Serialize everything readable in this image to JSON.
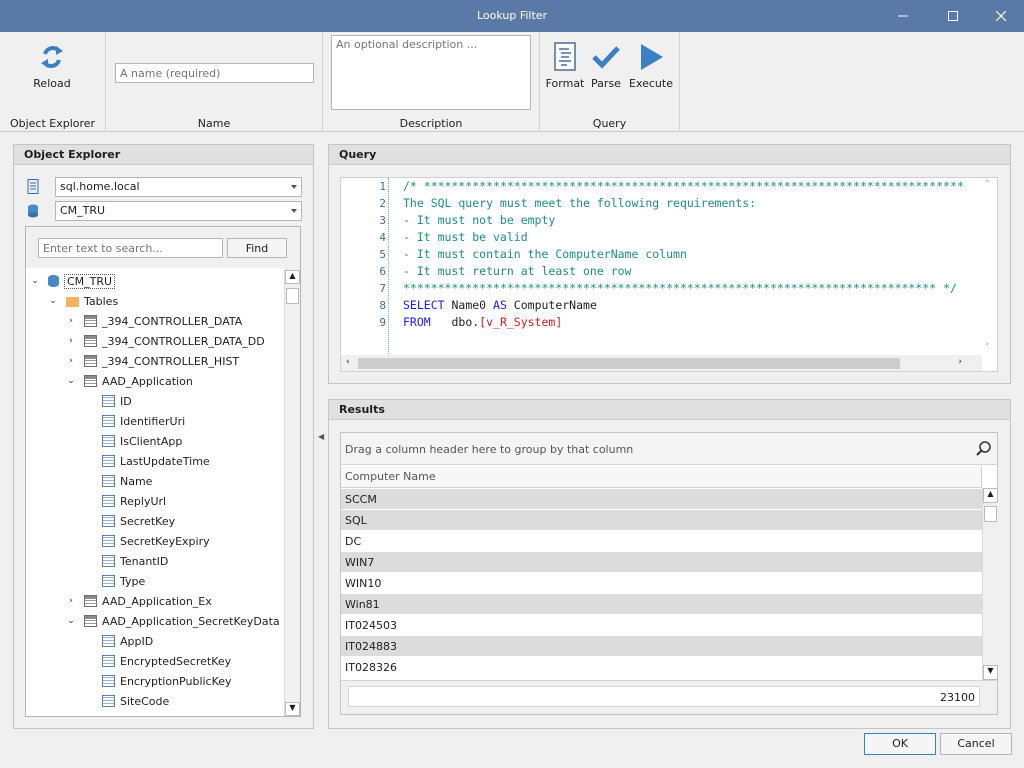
{
  "window": {
    "title": "Lookup Filter"
  },
  "ribbon": {
    "reload_label": "Reload",
    "group_object_explorer": "Object Explorer",
    "name_placeholder": "A name (required)",
    "group_name": "Name",
    "description_placeholder": "An optional description ...",
    "group_description": "Description",
    "format_label": "Format",
    "parse_label": "Parse",
    "execute_label": "Execute",
    "group_query": "Query"
  },
  "object_explorer": {
    "title": "Object Explorer",
    "server": "sql.home.local",
    "database": "CM_TRU",
    "search_placeholder": "Enter text to search...",
    "find_label": "Find",
    "tree": [
      {
        "label": "CM_TRU",
        "icon": "database-icon",
        "expander": "expanded"
      },
      {
        "label": "Tables",
        "icon": "folder-icon",
        "expander": "expanded"
      },
      {
        "label": "_394_CONTROLLER_DATA",
        "icon": "table-icon",
        "expander": "collapsed"
      },
      {
        "label": "_394_CONTROLLER_DATA_DD",
        "icon": "table-icon",
        "expander": "collapsed"
      },
      {
        "label": "_394_CONTROLLER_HIST",
        "icon": "table-icon",
        "expander": "collapsed"
      },
      {
        "label": "AAD_Application",
        "icon": "table-icon",
        "expander": "expanded"
      },
      {
        "label": "ID",
        "icon": "column-icon",
        "expander": "none"
      },
      {
        "label": "IdentifierUri",
        "icon": "column-icon",
        "expander": "none"
      },
      {
        "label": "IsClientApp",
        "icon": "column-icon",
        "expander": "none"
      },
      {
        "label": "LastUpdateTime",
        "icon": "column-icon",
        "expander": "none"
      },
      {
        "label": "Name",
        "icon": "column-icon",
        "expander": "none"
      },
      {
        "label": "ReplyUrl",
        "icon": "column-icon",
        "expander": "none"
      },
      {
        "label": "SecretKey",
        "icon": "column-icon",
        "expander": "none"
      },
      {
        "label": "SecretKeyExpiry",
        "icon": "column-icon",
        "expander": "none"
      },
      {
        "label": "TenantID",
        "icon": "column-icon",
        "expander": "none"
      },
      {
        "label": "Type",
        "icon": "column-icon",
        "expander": "none"
      },
      {
        "label": "AAD_Application_Ex",
        "icon": "table-icon",
        "expander": "collapsed"
      },
      {
        "label": "AAD_Application_SecretKeyData",
        "icon": "table-icon",
        "expander": "expanded"
      },
      {
        "label": "AppID",
        "icon": "column-icon",
        "expander": "none"
      },
      {
        "label": "EncryptedSecretKey",
        "icon": "column-icon",
        "expander": "none"
      },
      {
        "label": "EncryptionPublicKey",
        "icon": "column-icon",
        "expander": "none"
      },
      {
        "label": "SiteCode",
        "icon": "column-icon",
        "expander": "none"
      }
    ]
  },
  "query": {
    "title": "Query",
    "line_numbers": [
      "1",
      "2",
      "3",
      "4",
      "5",
      "6",
      "7",
      "8",
      "9"
    ],
    "lines": [
      [
        {
          "t": "/* ******************************************************************************",
          "c": "cm"
        }
      ],
      [
        {
          "t": "The SQL query must meet the following requirements:",
          "c": "cm"
        }
      ],
      [
        {
          "t": "- It must not be empty",
          "c": "cm"
        }
      ],
      [
        {
          "t": "- It must be valid",
          "c": "cm"
        }
      ],
      [
        {
          "t": "- It must contain the ComputerName column",
          "c": "cm"
        }
      ],
      [
        {
          "t": "- It must return at least one row",
          "c": "cm"
        }
      ],
      [
        {
          "t": "***************************************************************************** */",
          "c": "cm"
        }
      ],
      [
        {
          "t": "SELECT",
          "c": "kw"
        },
        {
          "t": " Name0 ",
          "c": ""
        },
        {
          "t": "AS",
          "c": "kw"
        },
        {
          "t": " ComputerName",
          "c": ""
        }
      ],
      [
        {
          "t": "FROM",
          "c": "kw"
        },
        {
          "t": "   dbo.",
          "c": ""
        },
        {
          "t": "[v_R_System]",
          "c": "tb"
        }
      ]
    ]
  },
  "results": {
    "title": "Results",
    "group_hint": "Drag a column header here to group by that column",
    "column_header": "Computer Name",
    "rows": [
      "SCCM",
      "SQL",
      "DC",
      "WIN7",
      "WIN10",
      "Win81",
      "IT024503",
      "IT024883",
      "IT028326"
    ],
    "footer_count": "23100"
  },
  "footer": {
    "ok_label": "OK",
    "cancel_label": "Cancel"
  },
  "colors": {
    "titlebar": "#5a79a6",
    "accent": "#3b7fc4"
  }
}
